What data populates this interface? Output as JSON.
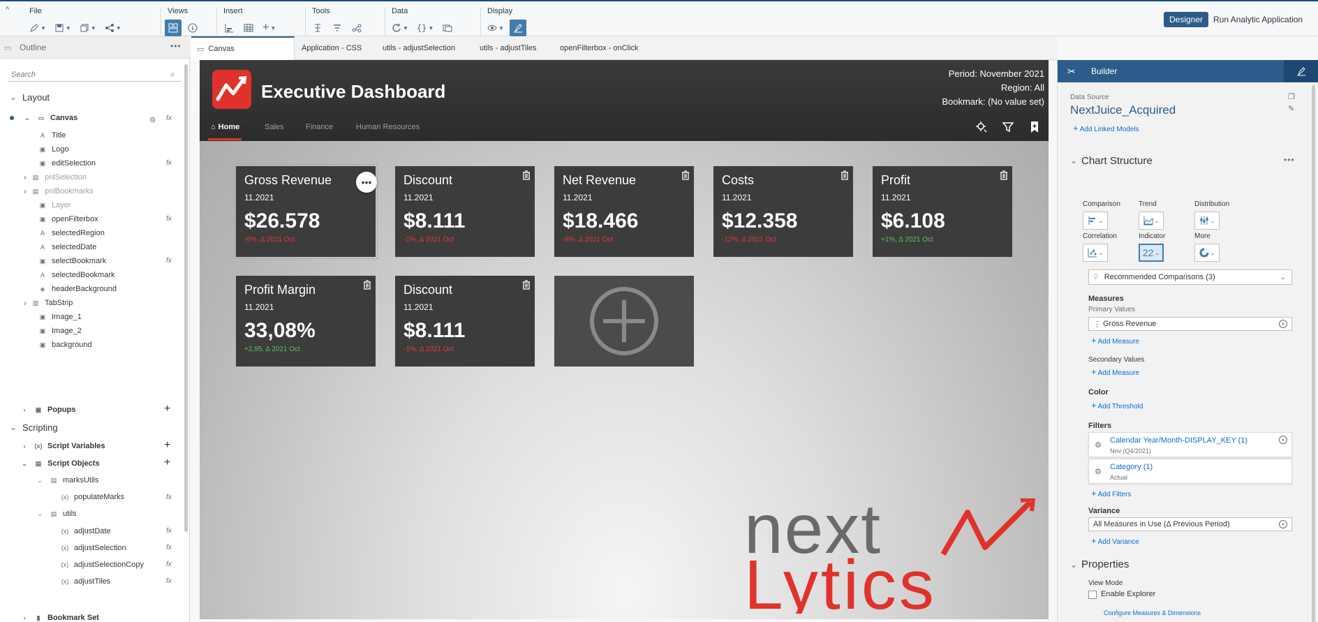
{
  "toolbar": {
    "groups": [
      {
        "label": "File"
      },
      {
        "label": "Views"
      },
      {
        "label": "Insert"
      },
      {
        "label": "Tools"
      },
      {
        "label": "Data"
      },
      {
        "label": "Display"
      }
    ],
    "designer_label": "Designer",
    "run_label": "Run Analytic Application"
  },
  "outline": {
    "title": "Outline",
    "search_placeholder": "Search",
    "layout_label": "Layout",
    "canvas_label": "Canvas",
    "items": [
      {
        "label": "Title",
        "icon": "text-icon",
        "fx": false,
        "grey": false
      },
      {
        "label": "Logo",
        "icon": "image-icon",
        "fx": false,
        "grey": false
      },
      {
        "label": "editSelection",
        "icon": "image-icon",
        "fx": true,
        "grey": false
      },
      {
        "label": "pnlSelection",
        "icon": "panel-icon",
        "fx": false,
        "grey": true
      },
      {
        "label": "pnlBookmarks",
        "icon": "panel-icon",
        "fx": false,
        "grey": true
      },
      {
        "label": "Layer",
        "icon": "image-icon",
        "fx": false,
        "grey": true
      },
      {
        "label": "openFilterbox",
        "icon": "image-icon",
        "fx": true,
        "grey": false
      },
      {
        "label": "selectedRegion",
        "icon": "text-icon",
        "fx": false,
        "grey": false
      },
      {
        "label": "selectedDate",
        "icon": "text-icon",
        "fx": false,
        "grey": false
      },
      {
        "label": "selectBookmark",
        "icon": "image-icon",
        "fx": true,
        "grey": false
      },
      {
        "label": "selectedBookmark",
        "icon": "text-icon",
        "fx": false,
        "grey": false
      },
      {
        "label": "headerBackground",
        "icon": "shape-icon",
        "fx": false,
        "grey": false
      },
      {
        "label": "TabStrip",
        "icon": "tabstrip-icon",
        "fx": false,
        "grey": false
      },
      {
        "label": "Image_1",
        "icon": "image-icon",
        "fx": false,
        "grey": false
      },
      {
        "label": "Image_2",
        "icon": "image-icon",
        "fx": false,
        "grey": false
      },
      {
        "label": "background",
        "icon": "image-icon",
        "fx": false,
        "grey": false
      }
    ],
    "popups_label": "Popups",
    "scripting_label": "Scripting",
    "script_variables_label": "Script Variables",
    "script_objects_label": "Script Objects",
    "marks_utils_label": "marksUtils",
    "populate_marks_label": "populateMarks",
    "utils_label": "utils",
    "utils_functions": [
      "adjustDate",
      "adjustSelection",
      "adjustSelectionCopy",
      "adjustTiles"
    ],
    "bookmark_set_label": "Bookmark Set"
  },
  "tabs": [
    "Canvas",
    "Application - CSS",
    "utils - adjustSelection",
    "utils - adjustTiles",
    "openFilterbox - onClick"
  ],
  "dashboard": {
    "title": "Executive Dashboard",
    "period": "Period: November 2021",
    "region": "Region: All",
    "bookmark": "Bookmark: (No value set)",
    "nav": [
      "Home",
      "Sales",
      "Finance",
      "Human Resources"
    ],
    "tiles": [
      {
        "name": "Gross Revenue",
        "date": "11.2021",
        "value": "$26.578",
        "variance": "-6%, Δ 2021 Oct",
        "positive": false
      },
      {
        "name": "Discount",
        "date": "11.2021",
        "value": "$8.111",
        "variance": "-1%, Δ 2021 Oct",
        "positive": false
      },
      {
        "name": "Net Revenue",
        "date": "11.2021",
        "value": "$18.466",
        "variance": "-8%, Δ 2021 Oct",
        "positive": false
      },
      {
        "name": "Costs",
        "date": "11.2021",
        "value": "$12.358",
        "variance": "-12%, Δ 2021 Oct",
        "positive": false
      },
      {
        "name": "Profit",
        "date": "11.2021",
        "value": "$6.108",
        "variance": "+1%, Δ 2021 Oct",
        "positive": true
      },
      {
        "name": "Profit Margin",
        "date": "11.2021",
        "value": "33,08%",
        "variance": "+2,95, Δ 2021 Oct",
        "positive": true
      },
      {
        "name": "Discount",
        "date": "11.2021",
        "value": "$8.111",
        "variance": "-1%, Δ 2021 Oct",
        "positive": false
      }
    ],
    "menu_dots": "•••",
    "brand_line1": "next",
    "brand_line2": "Lytics"
  },
  "builder": {
    "title": "Builder",
    "data_source_label": "Data Source",
    "data_source_value": "NextJuice_Acquired",
    "add_linked_models": "Add Linked Models",
    "chart_structure": "Chart Structure",
    "chart_types": [
      {
        "label": "Comparison",
        "icon": "bar-chart-icon"
      },
      {
        "label": "Trend",
        "icon": "area-chart-icon"
      },
      {
        "label": "Distribution",
        "icon": "boxplot-icon"
      },
      {
        "label": "Correlation",
        "icon": "scatter-icon"
      },
      {
        "label": "Indicator",
        "icon": "numeric-point-icon",
        "selected": true,
        "glyph": "22"
      },
      {
        "label": "More",
        "icon": "donut-icon"
      }
    ],
    "recommended": "Recommended Comparisons (3)",
    "measures": "Measures",
    "primary_values": "Primary Values",
    "primary_measure": "Gross Revenue",
    "add_measure": "Add Measure",
    "secondary_values": "Secondary Values",
    "color": "Color",
    "add_threshold": "Add Threshold",
    "filters_label": "Filters",
    "filters": [
      {
        "name": "Calendar Year/Month-DISPLAY_KEY (1)",
        "value": "Nov (Q4/2021)"
      },
      {
        "name": "Category (1)",
        "value": "Actual"
      }
    ],
    "add_filters": "Add Filters",
    "variance_label": "Variance",
    "variance_value": "All Measures in Use (Δ Previous Period)",
    "add_variance": "Add Variance",
    "properties": "Properties",
    "view_mode": "View Mode",
    "enable_explorer": "Enable Explorer",
    "configure": "Configure Measures & Dimensions"
  },
  "colors": {
    "accent": "#2d5c8a",
    "brand_red": "#e0322b",
    "negative": "#e8363a",
    "positive": "#5cc05c"
  }
}
